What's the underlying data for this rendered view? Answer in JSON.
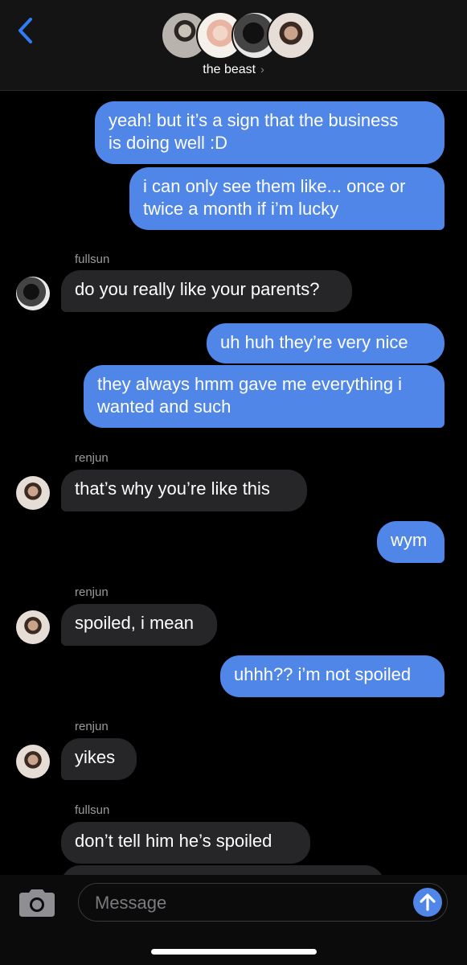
{
  "header": {
    "group_name": "the beast",
    "chevron": "›"
  },
  "messages": [
    {
      "id": "m1",
      "dir": "out",
      "text": "yeah! but it’s a sign that the business\nis doing well :D"
    },
    {
      "id": "m2",
      "dir": "out",
      "text": "i can only see them like... once or\ntwice a month if i’m lucky"
    },
    {
      "id": "m3",
      "dir": "in",
      "sender": "fullsun",
      "text": "do you really like your parents?"
    },
    {
      "id": "m4",
      "dir": "out",
      "text": "uh huh they’re very nice"
    },
    {
      "id": "m5",
      "dir": "out",
      "text": "they always hmm gave me everything i\nwanted and such"
    },
    {
      "id": "m6",
      "dir": "in",
      "sender": "renjun",
      "text": "that’s why you’re like this"
    },
    {
      "id": "m7",
      "dir": "out",
      "text": "wym"
    },
    {
      "id": "m8",
      "dir": "in",
      "sender": "renjun",
      "text": "spoiled, i mean"
    },
    {
      "id": "m9",
      "dir": "out",
      "text": "uhhh?? i’m not spoiled"
    },
    {
      "id": "m10",
      "dir": "in",
      "sender": "renjun",
      "text": "yikes"
    },
    {
      "id": "m11",
      "dir": "in",
      "sender": "fullsun",
      "text": "don’t tell him he’s spoiled"
    }
  ],
  "input": {
    "placeholder": "Message"
  },
  "colors": {
    "outgoing_bubble": "#4f86e8",
    "incoming_bubble": "#262628",
    "accent": "#2f7cf6"
  },
  "icons": [
    "chevron-left-icon",
    "camera-icon",
    "arrow-up-icon"
  ]
}
